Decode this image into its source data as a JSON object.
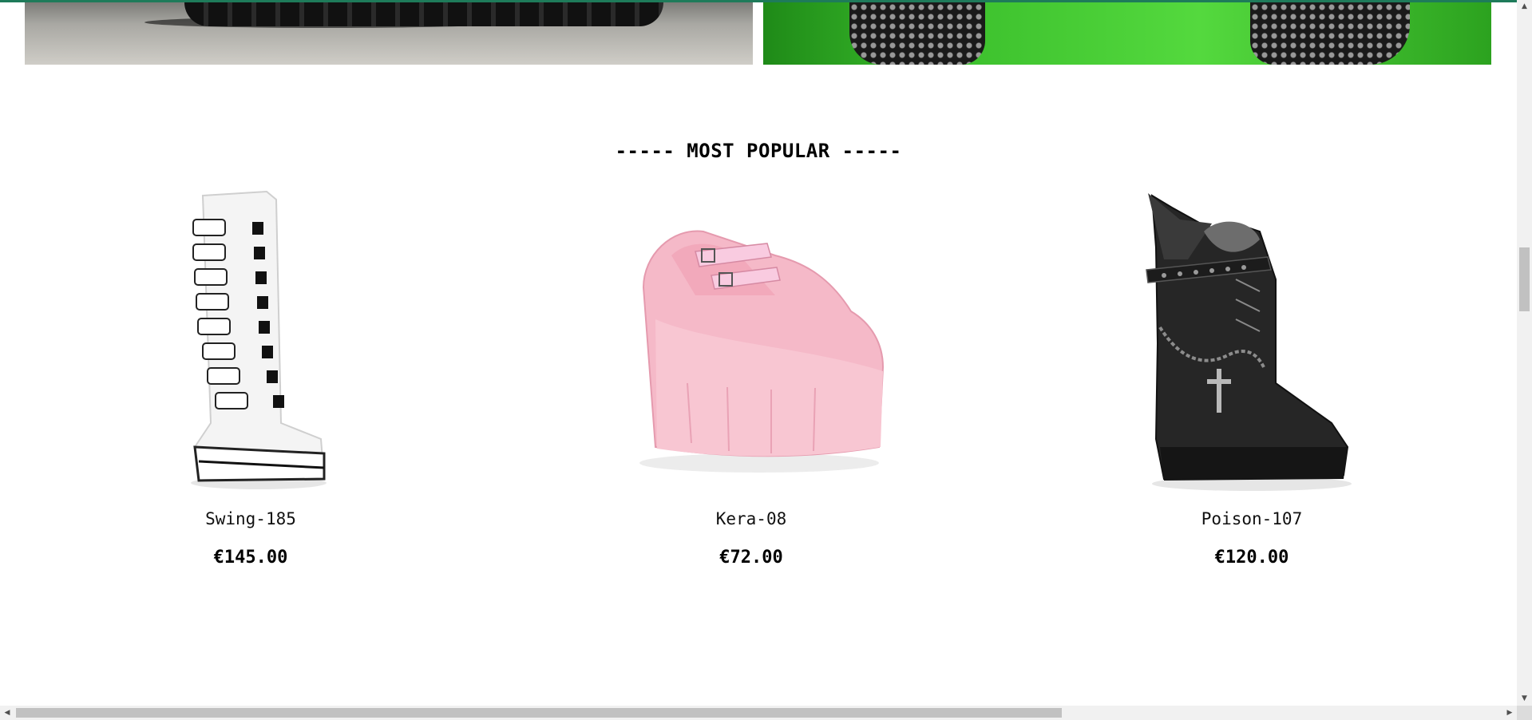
{
  "banners": [
    {
      "name": "banner-left",
      "alt": "platform boots on pavement"
    },
    {
      "name": "banner-right",
      "alt": "fishnet legs on green background"
    }
  ],
  "section": {
    "title": "----- MOST POPULAR -----"
  },
  "products": [
    {
      "name": "Swing-185",
      "price": "€145.00",
      "image": "white-buckle-boot"
    },
    {
      "name": "Kera-08",
      "price": "€72.00",
      "image": "pink-mary-jane-platform"
    },
    {
      "name": "Poison-107",
      "price": "€120.00",
      "image": "black-wedge-boot"
    }
  ],
  "colors": {
    "accent_top_bar": "#1e7b5a",
    "background": "#ffffff",
    "text": "#000000"
  },
  "scrollbars": {
    "vertical": {
      "up_icon": "arrow-up-icon",
      "down_icon": "arrow-down-icon"
    },
    "horizontal": {
      "left_icon": "arrow-left-icon",
      "right_icon": "arrow-right-icon"
    }
  }
}
